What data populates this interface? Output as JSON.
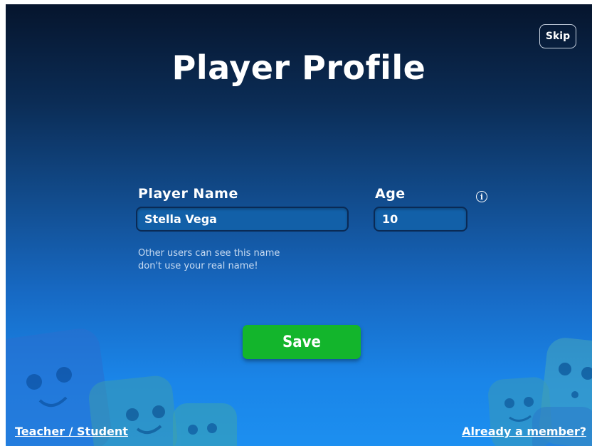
{
  "header": {
    "title": "Player Profile",
    "skip_label": "Skip"
  },
  "form": {
    "name_label": "Player Name",
    "name_value": "Stella Vega",
    "age_label": "Age",
    "age_value": "10",
    "hint_line1": "Other users can see this name",
    "hint_line2": "don't use your real name!"
  },
  "actions": {
    "save_label": "Save"
  },
  "footer": {
    "left_link": "Teacher / Student",
    "right_link": "Already a member?"
  },
  "icons": {
    "info": "info-icon",
    "mascots": "mascot-characters"
  },
  "colors": {
    "save_button": "#13b52c",
    "background_top": "#06152d",
    "background_bottom": "#1c8ff0"
  }
}
